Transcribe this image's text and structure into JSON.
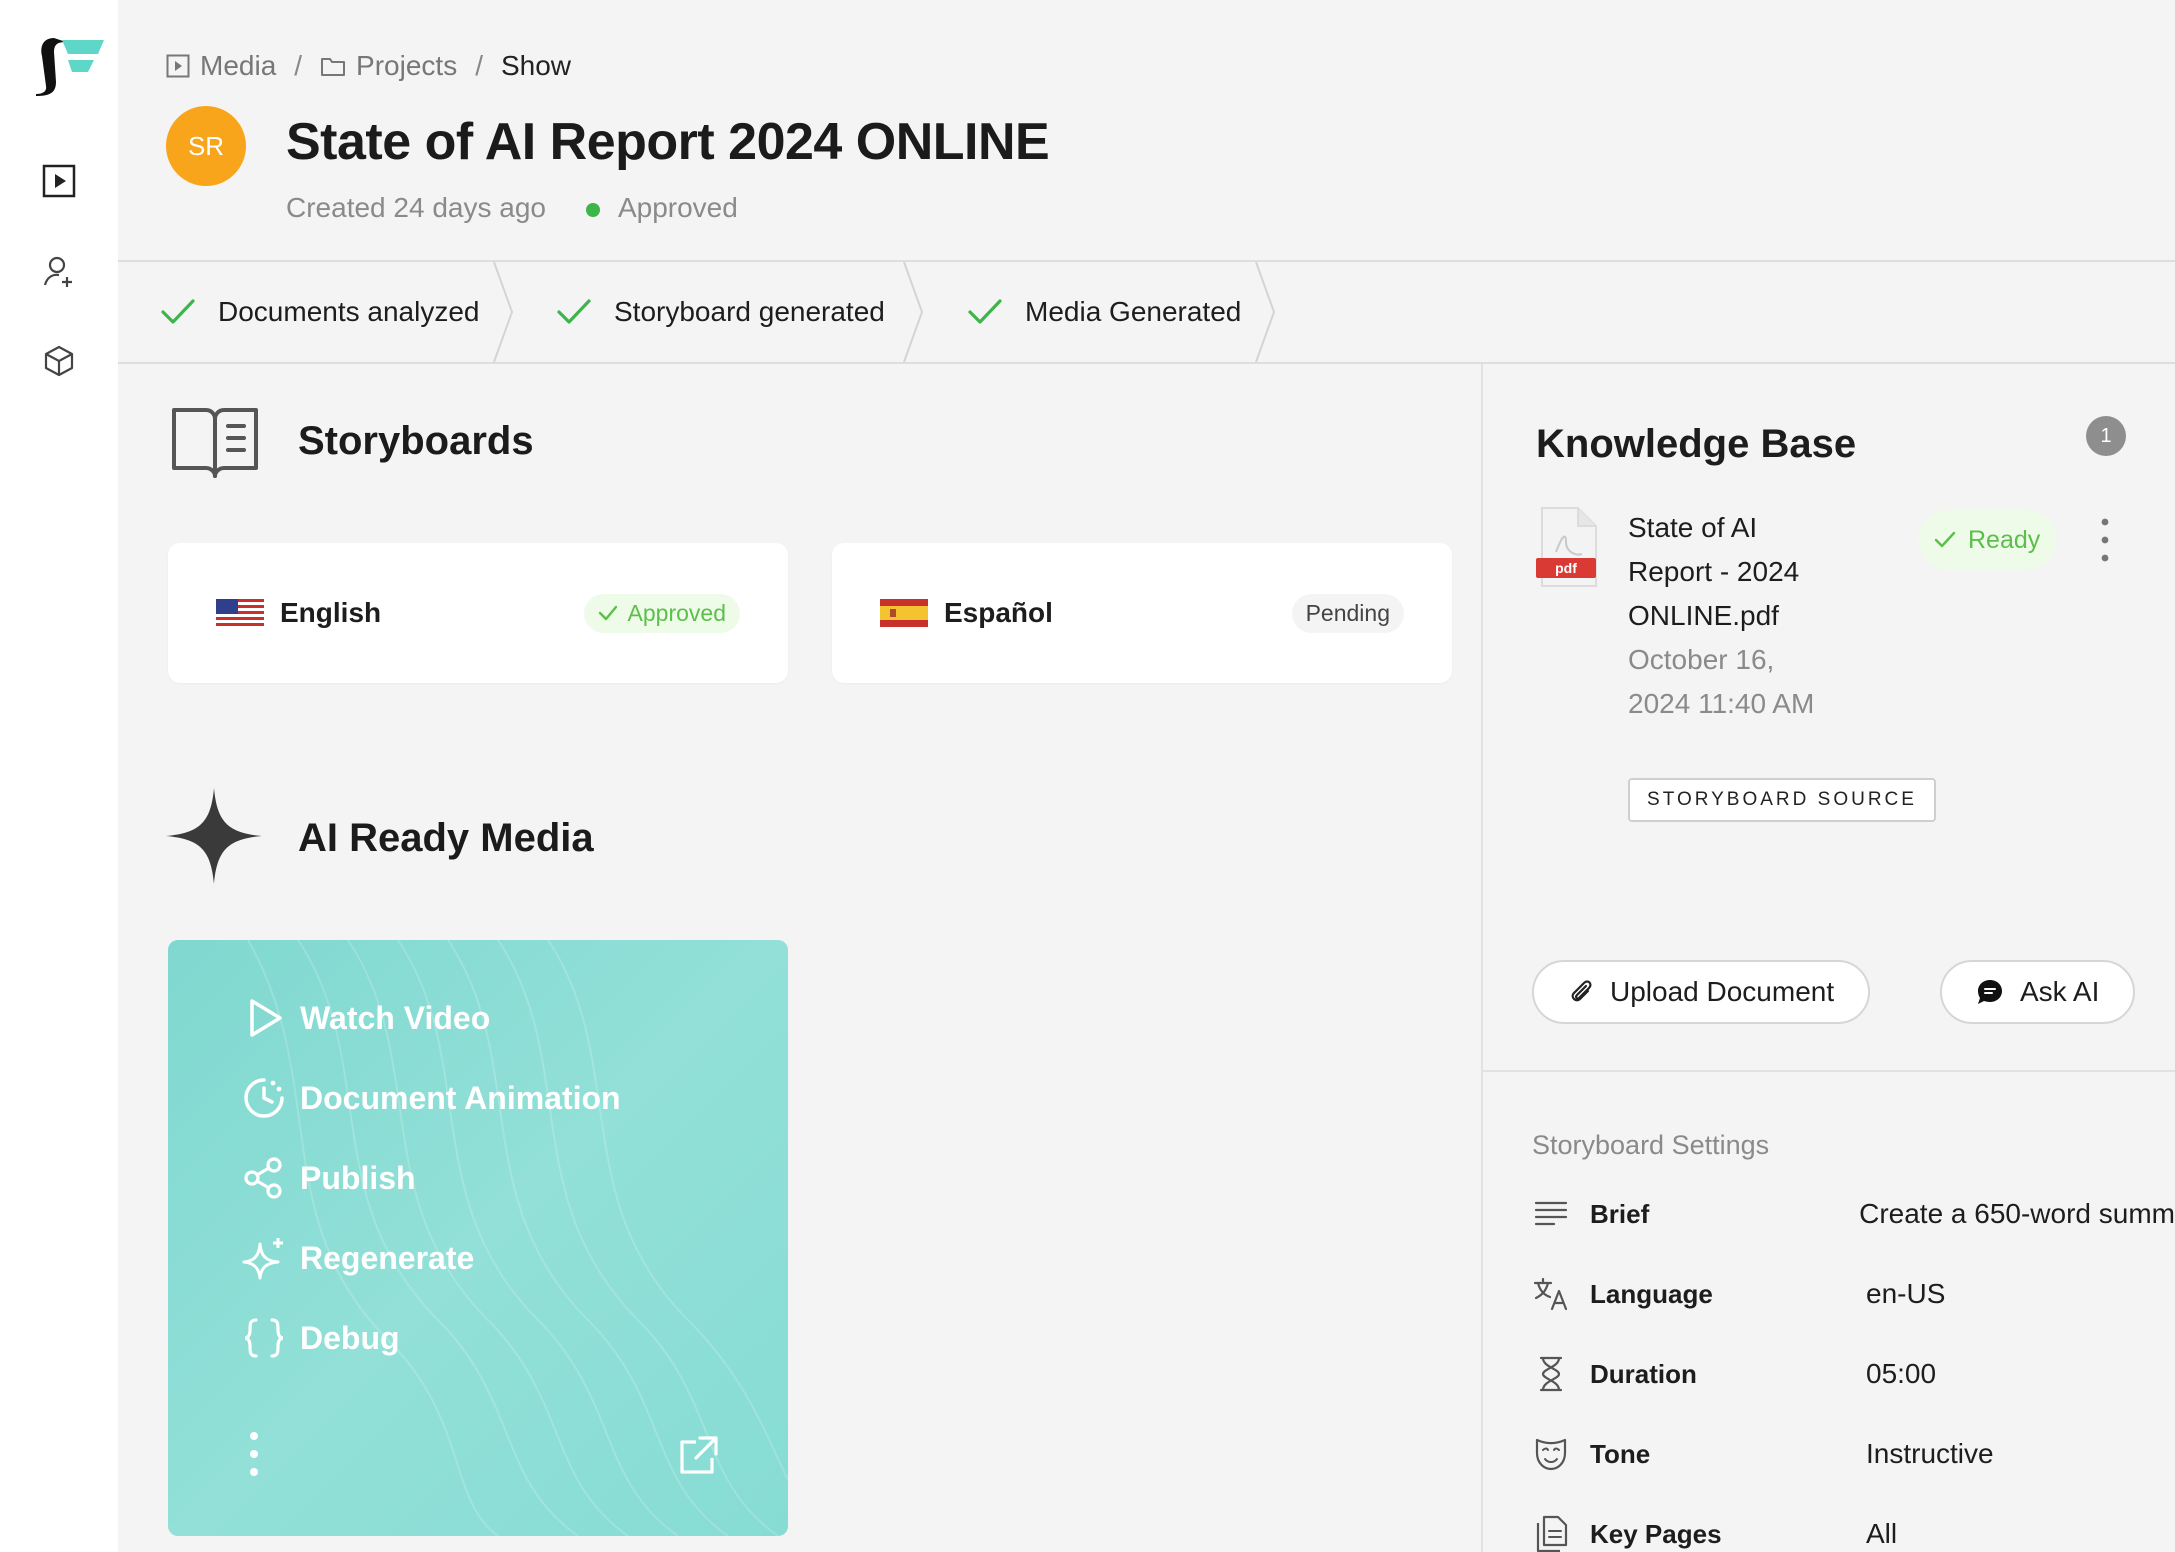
{
  "breadcrumb": [
    {
      "label": "Media",
      "icon": "play-square-icon"
    },
    {
      "label": "Projects",
      "icon": "folder-icon"
    },
    {
      "label": "Show"
    }
  ],
  "header": {
    "avatar_initials": "SR",
    "title": "State of AI Report 2024 ONLINE",
    "created": "Created 24 days ago",
    "status": "Approved"
  },
  "steps": [
    {
      "label": "Documents analyzed"
    },
    {
      "label": "Storyboard generated"
    },
    {
      "label": "Media Generated"
    }
  ],
  "storyboards": {
    "title": "Storyboards",
    "items": [
      {
        "language": "English",
        "status": "Approved"
      },
      {
        "language": "Español",
        "status": "Pending"
      }
    ]
  },
  "media": {
    "title": "AI Ready Media",
    "actions": [
      {
        "label": "Watch Video",
        "icon": "play-icon"
      },
      {
        "label": "Document Animation",
        "icon": "timer-icon"
      },
      {
        "label": "Publish",
        "icon": "share-icon"
      },
      {
        "label": "Regenerate",
        "icon": "sparkle-icon"
      },
      {
        "label": "Debug",
        "icon": "braces-icon"
      }
    ]
  },
  "knowledge_base": {
    "title": "Knowledge Base",
    "count": "1",
    "document": {
      "name": "State of AI Report - 2024 ONLINE.pdf",
      "date": "October 16, 2024 11:40 AM",
      "tag": "STORYBOARD SOURCE",
      "status": "Ready",
      "file_label": "pdf"
    },
    "upload_label": "Upload Document",
    "ask_label": "Ask AI"
  },
  "settings": {
    "title": "Storyboard Settings",
    "rows": [
      {
        "label": "Brief",
        "value": "Create a 650-word summ"
      },
      {
        "label": "Language",
        "value": "en-US"
      },
      {
        "label": "Duration",
        "value": "05:00"
      },
      {
        "label": "Tone",
        "value": "Instructive"
      },
      {
        "label": "Key Pages",
        "value": "All"
      }
    ]
  },
  "colors": {
    "accent_teal": "#5ed6c8",
    "avatar": "#f8a51b",
    "success": "#3cb54a",
    "media_card": "#86dcd3"
  }
}
